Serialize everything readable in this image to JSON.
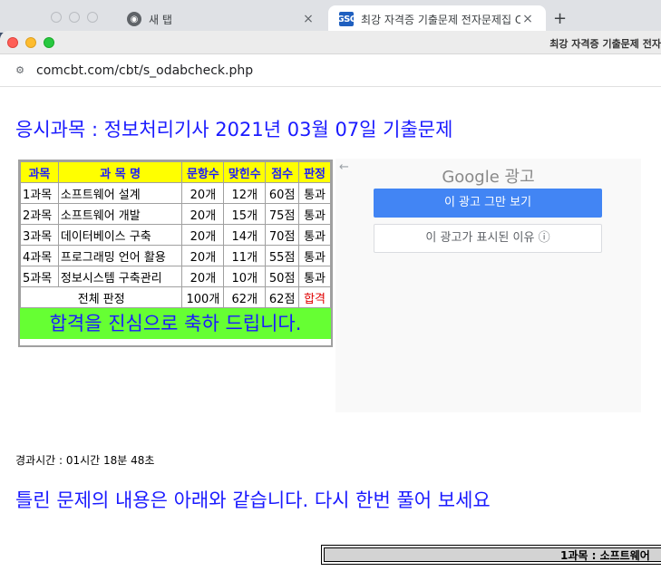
{
  "tabs": [
    {
      "title": "새 탭",
      "close": "×"
    },
    {
      "title": "최강 자격증 기출문제 전자문제집 C",
      "close": "×"
    }
  ],
  "new_tab_symbol": "+",
  "window_title": "최강 자격증 기출문제 전자",
  "url": "comcbt.com/cbt/s_odabcheck.php",
  "exam_title": "응시과목 : 정보처리기사 2021년 03월 07일 기출문제",
  "result_table": {
    "headers": [
      "과목",
      "과 목 명",
      "문항수",
      "맞힌수",
      "점수",
      "판정"
    ],
    "rows": [
      [
        "1과목",
        "소프트웨어 설계",
        "20개",
        "12개",
        "60점",
        "통과"
      ],
      [
        "2과목",
        "소프트웨어 개발",
        "20개",
        "15개",
        "75점",
        "통과"
      ],
      [
        "3과목",
        "데이터베이스 구축",
        "20개",
        "14개",
        "70점",
        "통과"
      ],
      [
        "4과목",
        "프로그래밍 언어 활용",
        "20개",
        "11개",
        "55점",
        "통과"
      ],
      [
        "5과목",
        "정보시스템 구축관리",
        "20개",
        "10개",
        "50점",
        "통과"
      ]
    ],
    "total": {
      "label": "전체 판정",
      "questions": "100개",
      "correct": "62개",
      "score": "62점",
      "verdict": "합격"
    },
    "congrats": "합격을 진심으로 축하 드립니다."
  },
  "ad": {
    "back_symbol": "←",
    "brand": "Google 광고",
    "stop_button": "이 광고 그만 보기",
    "why_button": "이 광고가 표시된 이유 ⓘ"
  },
  "elapsed": "경과시간 : 01시간 18분 48초",
  "retry_message": "틀린 문제의 내용은 아래와 같습니다. 다시 한번 풀어 보세요",
  "subject_header": "1과목 : 소프트웨어",
  "colors": {
    "title_blue": "#1a1aff",
    "header_yellow": "#ffff00",
    "congrats_green": "#66ff33",
    "pass_red": "#e00000",
    "ad_button_blue": "#4285f4"
  }
}
